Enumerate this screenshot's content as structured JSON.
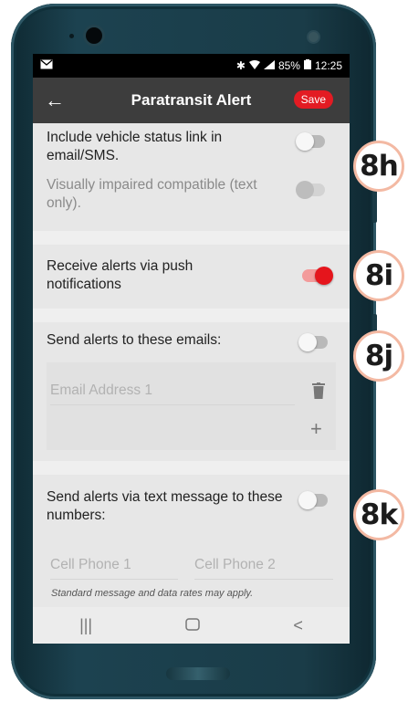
{
  "statusbar": {
    "battery": "85%",
    "time": "12:25"
  },
  "appbar": {
    "title": "Paratransit Alert",
    "save_label": "Save"
  },
  "settings": {
    "vehicle_status": {
      "label": "Include vehicle status link in email/SMS.",
      "enabled": false
    },
    "visually_impaired": {
      "label": "Visually impaired compatible (text only).",
      "enabled": false,
      "disabled": true
    },
    "push": {
      "label": "Receive alerts via push notifications",
      "enabled": true
    },
    "emails": {
      "label": "Send alerts to these emails:",
      "enabled": false,
      "placeholder": "Email Address 1"
    },
    "sms": {
      "label": "Send alerts via text message to these numbers:",
      "enabled": false,
      "phone1_placeholder": "Cell Phone 1",
      "phone2_placeholder": "Cell Phone 2",
      "note": "Standard message and data rates may apply."
    }
  },
  "badges": [
    "8h",
    "8i",
    "8j",
    "8k"
  ],
  "colors": {
    "accent": "#e31b23",
    "appbar": "#3d3d3d",
    "badge_border": "#f3b9a3"
  }
}
